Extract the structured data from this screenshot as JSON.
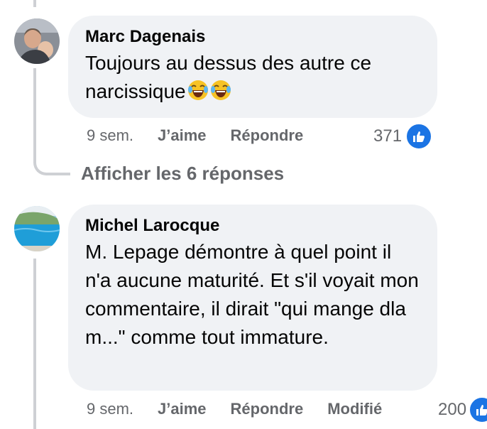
{
  "comments": [
    {
      "author": "Marc Dagenais",
      "text": "Toujours au dessus des autre ce narcissique",
      "emoji": [
        "face-with-tears-of-joy",
        "face-with-tears-of-joy"
      ],
      "time": "9 sem.",
      "like_label": "J’aime",
      "reply_label": "Répondre",
      "reaction_count": "371",
      "reaction_icon": "like-thumb-icon"
    },
    {
      "author": "Michel Larocque",
      "text": "M. Lepage démontre à quel point il n'a aucune maturité. Et s'il voyait mon commentaire, il dirait \"qui mange dla m...\" comme tout immature.",
      "time": "9 sem.",
      "like_label": "J’aime",
      "reply_label": "Répondre",
      "edited_label": "Modifié",
      "reaction_count": "200",
      "reaction_icon": "like-thumb-icon"
    }
  ],
  "replies_link": "Afficher les 6 réponses",
  "colors": {
    "bubble": "#f0f2f5",
    "meta_text": "#65676b",
    "like_blue": "#1b74e4",
    "thread_line": "#ced0d4"
  }
}
